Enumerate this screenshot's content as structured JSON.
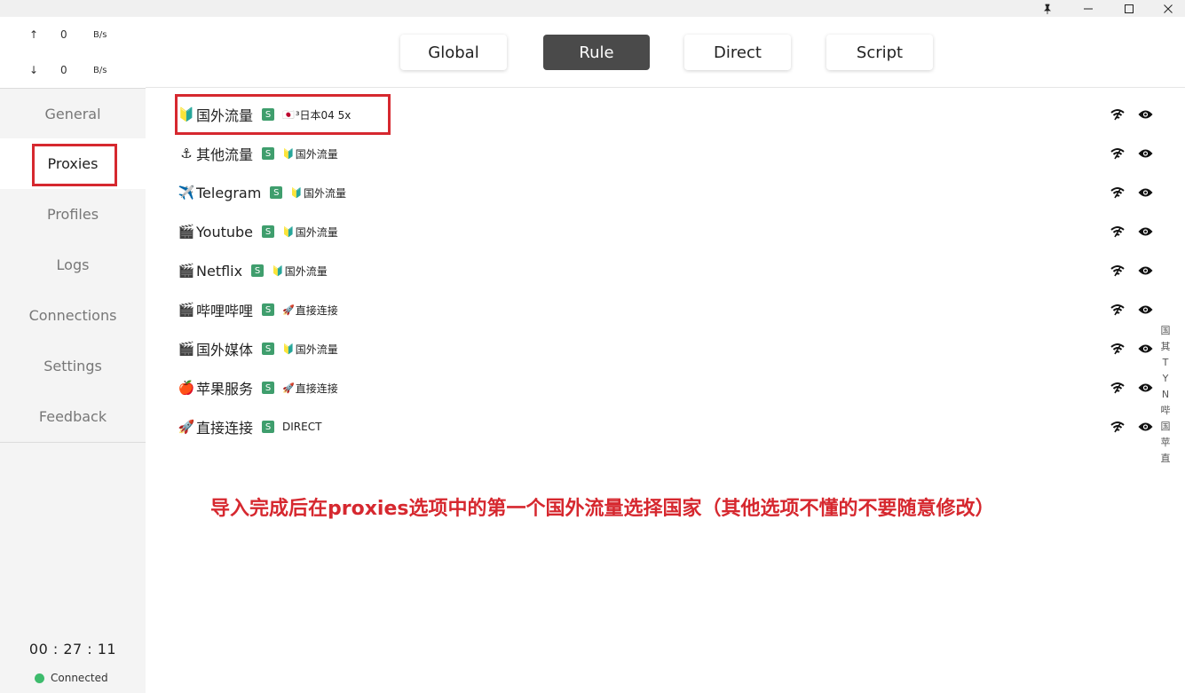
{
  "window_controls": {
    "pin": "🖈",
    "minimize": "—",
    "maximize": "☐",
    "close": "✕"
  },
  "traffic": {
    "upload": {
      "arrow": "↑",
      "value": "0",
      "unit": "B/s"
    },
    "download": {
      "arrow": "↓",
      "value": "0",
      "unit": "B/s"
    }
  },
  "nav": {
    "items": [
      {
        "label": "General"
      },
      {
        "label": "Proxies"
      },
      {
        "label": "Profiles"
      },
      {
        "label": "Logs"
      },
      {
        "label": "Connections"
      },
      {
        "label": "Settings"
      },
      {
        "label": "Feedback"
      }
    ],
    "active": "Proxies"
  },
  "footer": {
    "timer": "00 : 27 : 11",
    "status": "Connected",
    "status_color": "#3dbb6c"
  },
  "modes": {
    "items": [
      {
        "label": "Global"
      },
      {
        "label": "Rule"
      },
      {
        "label": "Direct"
      },
      {
        "label": "Script"
      }
    ],
    "active": "Rule"
  },
  "groups": [
    {
      "icon": "🔰",
      "name": "国外流量",
      "badge": "S",
      "sel_icon": "🇯🇵",
      "selected": "³日本04 5x"
    },
    {
      "icon": "⚓",
      "name": "其他流量",
      "badge": "S",
      "sel_icon": "🔰",
      "selected": "国外流量"
    },
    {
      "icon": "✈️",
      "name": "Telegram",
      "badge": "S",
      "sel_icon": "🔰",
      "selected": "国外流量"
    },
    {
      "icon": "🎬",
      "name": "Youtube",
      "badge": "S",
      "sel_icon": "🔰",
      "selected": "国外流量"
    },
    {
      "icon": "🎬",
      "name": "Netflix",
      "badge": "S",
      "sel_icon": "🔰",
      "selected": "国外流量"
    },
    {
      "icon": "🎬",
      "name": "哔哩哔哩",
      "badge": "S",
      "sel_icon": "🚀",
      "selected": "直接连接"
    },
    {
      "icon": "🎬",
      "name": "国外媒体",
      "badge": "S",
      "sel_icon": "🔰",
      "selected": "国外流量"
    },
    {
      "icon": "🍎",
      "name": "苹果服务",
      "badge": "S",
      "sel_icon": "🚀",
      "selected": "直接连接"
    },
    {
      "icon": "🚀",
      "name": "直接连接",
      "badge": "S",
      "sel_icon": "",
      "selected": "DIRECT"
    }
  ],
  "index_letters": [
    "国",
    "其",
    "T",
    "Y",
    "N",
    "哔",
    "国",
    "苹",
    "直"
  ],
  "annotation": "导入完成后在proxies选项中的第一个国外流量选择国家（其他选项不懂的不要随意修改）",
  "colors": {
    "accent_red": "#d6282f",
    "badge_green": "#3f9e6d",
    "active_mode": "#4a4a4a"
  }
}
